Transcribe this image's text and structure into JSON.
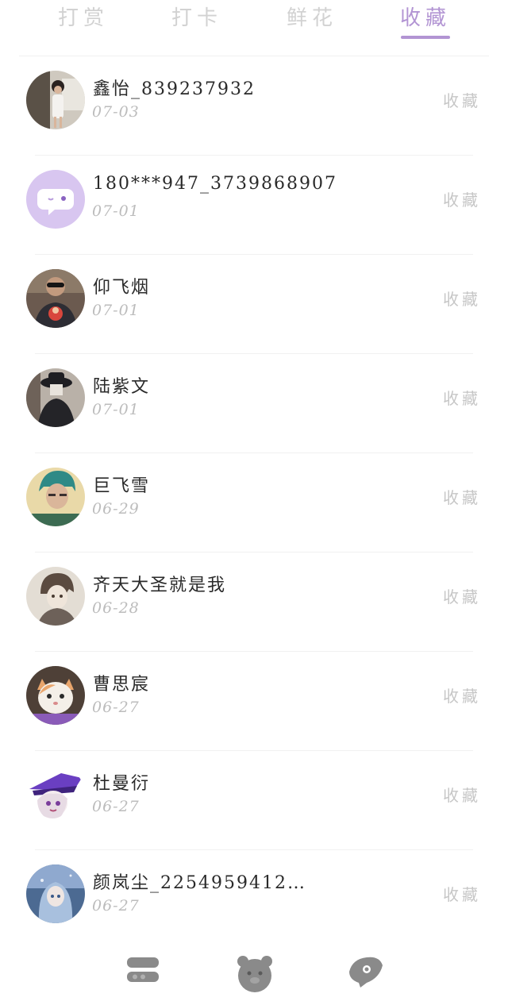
{
  "tabs": [
    {
      "label": "打赏",
      "active": false
    },
    {
      "label": "打卡",
      "active": false
    },
    {
      "label": "鲜花",
      "active": false
    },
    {
      "label": "收藏",
      "active": true
    }
  ],
  "colors": {
    "accent": "#b294d3",
    "muted": "#c6c6c6"
  },
  "items": [
    {
      "name": "鑫怡_839237932",
      "date": "07-03",
      "action": "收藏",
      "avatar": "photo-girl-avatar"
    },
    {
      "name": "180***947_3739868907",
      "date": "07-01",
      "action": "收藏",
      "avatar": "default-chat-avatar"
    },
    {
      "name": "仰飞烟",
      "date": "07-01",
      "action": "收藏",
      "avatar": "photo-man-sunglasses-avatar"
    },
    {
      "name": "陆紫文",
      "date": "07-01",
      "action": "收藏",
      "avatar": "photo-hat-avatar"
    },
    {
      "name": "巨飞雪",
      "date": "06-29",
      "action": "收藏",
      "avatar": "photo-anime-green-hair-avatar"
    },
    {
      "name": "齐天大圣就是我",
      "date": "06-28",
      "action": "收藏",
      "avatar": "sketch-boy-avatar"
    },
    {
      "name": "曹思宸",
      "date": "06-27",
      "action": "收藏",
      "avatar": "photo-cat-avatar"
    },
    {
      "name": "杜曼衍",
      "date": "06-27",
      "action": "收藏",
      "avatar": "anime-purple-hat-avatar"
    },
    {
      "name": "颜岚尘_2254959412…",
      "date": "06-27",
      "action": "收藏",
      "avatar": "anime-blue-girl-avatar"
    }
  ],
  "bottom_nav": [
    {
      "icon": "toggle-menu-icon"
    },
    {
      "icon": "bear-face-icon"
    },
    {
      "icon": "leaf-heart-icon"
    }
  ]
}
